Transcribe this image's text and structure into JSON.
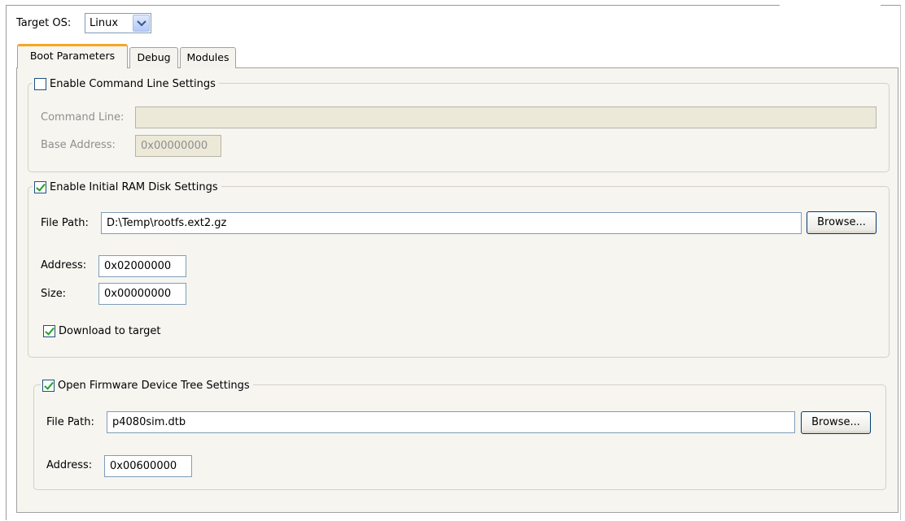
{
  "target_os": {
    "label": "Target OS:",
    "value": "Linux"
  },
  "tabs": [
    {
      "label": "Boot Parameters",
      "active": true
    },
    {
      "label": "Debug",
      "active": false
    },
    {
      "label": "Modules",
      "active": false
    }
  ],
  "command_line_group": {
    "legend": "Enable Command Line Settings",
    "enabled": false,
    "command_line_label": "Command Line:",
    "command_line_value": "",
    "base_address_label": "Base Address:",
    "base_address_value": "0x00000000"
  },
  "ram_disk_group": {
    "legend": "Enable Initial RAM Disk Settings",
    "enabled": true,
    "file_path_label": "File Path:",
    "file_path_value": "D:\\Temp\\rootfs.ext2.gz",
    "browse_label": "Browse...",
    "address_label": "Address:",
    "address_value": "0x02000000",
    "size_label": "Size:",
    "size_value": "0x00000000",
    "download_label": "Download to target",
    "download_checked": true
  },
  "device_tree_group": {
    "legend": "Open Firmware Device Tree Settings",
    "enabled": true,
    "file_path_label": "File Path:",
    "file_path_value": "p4080sim.dtb",
    "browse_label": "Browse...",
    "address_label": "Address:",
    "address_value": "0x00600000"
  },
  "colors": {
    "active_tab_accent": "#f5a623",
    "checkmark": "#21a121",
    "panel_bg": "#f6f5f0"
  },
  "icons": {
    "dropdown": "chevron-down-icon",
    "check": "checkmark-icon"
  }
}
